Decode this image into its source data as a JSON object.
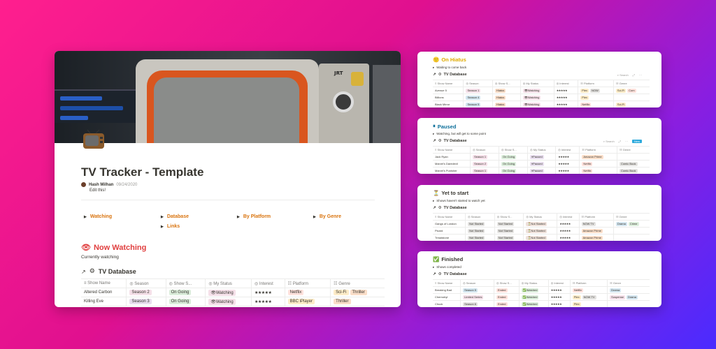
{
  "main": {
    "page_icon": "tv-icon",
    "title": "TV Tracker - Template",
    "author": "Hash Milhan",
    "date": "09/24/2020",
    "edit_note": "Edit this!",
    "toggles": [
      "Watching",
      "Database",
      "Links",
      "By Platform",
      "By Genre"
    ],
    "section": {
      "emoji": "👁",
      "title": "Now Watching",
      "subtitle": "Currently watching"
    },
    "db_title": "TV Database",
    "columns": [
      "Show Name",
      "Season",
      "Show S...",
      "My Status",
      "Interest",
      "Platform",
      "Genre"
    ],
    "rows": [
      {
        "name": "Altered Carbon",
        "season": "Season 2",
        "show_status": "On Going",
        "my_status": "👁Watching",
        "interest": "★★★★★",
        "platform": [
          "Netflix"
        ],
        "genre": [
          "Sci-Fi",
          "Thriller"
        ]
      },
      {
        "name": "Killing Eve",
        "season": "Season 3",
        "show_status": "On Going",
        "my_status": "👁Watching",
        "interest": "★★★★★",
        "platform": [
          "BBC iPlayer"
        ],
        "genre": [
          "Thriller"
        ]
      }
    ]
  },
  "hiatus": {
    "emoji": "🙂",
    "title": "On Hiatus",
    "subtitle": "Waiting to come back",
    "db_title": "TV Database",
    "search": "Search",
    "new": "New",
    "columns": [
      "Show Name",
      "Season",
      "Show S...",
      "My Status",
      "Interest",
      "Platform",
      "Genre"
    ],
    "rows": [
      {
        "name": "Avenue 5",
        "season": "Season 1",
        "show_status": "Hiatus",
        "my_status": "👁Watching",
        "interest": "★★★★★",
        "platform": [
          "Plex",
          "NOW"
        ],
        "genre": [
          "Sci-Fi",
          "Com"
        ]
      },
      {
        "name": "Billions",
        "season": "Season 4",
        "show_status": "Hiatus",
        "my_status": "👁Watching",
        "interest": "★★★★★",
        "platform": [
          "Plex"
        ],
        "genre": []
      },
      {
        "name": "Black Mirror",
        "season": "Season 5",
        "show_status": "Hiatus",
        "my_status": "👁Watching",
        "interest": "★★★★★",
        "platform": [
          "Netflix"
        ],
        "genre": [
          "Sci-Fi"
        ]
      }
    ]
  },
  "paused": {
    "emoji": "⏸",
    "title": "Paused",
    "subtitle": "Watching, but will get to some point",
    "db_title": "TV Database",
    "search": "Search",
    "new": "New",
    "columns": [
      "Show Name",
      "Season",
      "Show S...",
      "My Status",
      "Interest",
      "Platform",
      "Genre"
    ],
    "rows": [
      {
        "name": "Jack Ryan",
        "season": "Season 1",
        "show_status": "On Going",
        "my_status": "⏸Paused",
        "interest": "★★★★★",
        "platform": [
          "Amazon Prime"
        ],
        "genre": []
      },
      {
        "name": "Marvel's Daredevil",
        "season": "Season 2",
        "show_status": "On Going",
        "my_status": "⏸Paused",
        "interest": "★★★★★",
        "platform": [
          "Netflix"
        ],
        "genre": [
          "Comic Book"
        ]
      },
      {
        "name": "Marvel's Punisher",
        "season": "Season 1",
        "show_status": "On Going",
        "my_status": "⏸Paused",
        "interest": "★★★★★",
        "platform": [
          "Netflix"
        ],
        "genre": [
          "Comic Book"
        ]
      }
    ]
  },
  "yet": {
    "emoji": "⏳",
    "title": "Yet to start",
    "subtitle": "Shows haven't started to watch yet",
    "db_title": "TV Database",
    "columns": [
      "Show Name",
      "Season",
      "Show S...",
      "My Status",
      "Interest",
      "Platform",
      "Genre"
    ],
    "rows": [
      {
        "name": "Gangs of London",
        "season": "Not Started",
        "show_status": "Not Started",
        "my_status": "⏳Not Started",
        "interest": "★★★★★",
        "platform": [
          "NOW TV"
        ],
        "genre": [
          "Drama",
          "Crime"
        ]
      },
      {
        "name": "Picard",
        "season": "Not Started",
        "show_status": "Not Started",
        "my_status": "⏳Not Started",
        "interest": "★★★★★",
        "platform": [
          "Amazon Prime"
        ],
        "genre": []
      },
      {
        "name": "Treadstone",
        "season": "Not Started",
        "show_status": "Not Started",
        "my_status": "⏳Not Started",
        "interest": "★★★★★",
        "platform": [
          "Amazon Prime"
        ],
        "genre": []
      }
    ]
  },
  "finished": {
    "emoji": "✅",
    "title": "Finished",
    "subtitle": "Shows completed",
    "db_title": "TV Database",
    "columns": [
      "Show Name",
      "Season",
      "Show S...",
      "My Status",
      "Interest",
      "Platform",
      "Genre"
    ],
    "rows": [
      {
        "name": "Breaking Bad",
        "season": "Season 5",
        "show_status": "Ended",
        "my_status": "✅Watched",
        "interest": "★★★★★",
        "platform": [
          "Netflix"
        ],
        "genre": [
          "Drama"
        ]
      },
      {
        "name": "Chernobyl",
        "season": "Limited Series",
        "show_status": "Ended",
        "my_status": "✅Watched",
        "interest": "★★★★★",
        "platform": [
          "Plex",
          "NOW TV"
        ],
        "genre": [
          "Suspense",
          "Drama"
        ]
      },
      {
        "name": "Chuck",
        "season": "Season 6",
        "show_status": "Ended",
        "my_status": "✅Watched",
        "interest": "★★★★★",
        "platform": [
          "Plex"
        ],
        "genre": []
      }
    ]
  },
  "colors": {
    "pink_tag": "#f5e0e9",
    "green_tag": "#dbeddb",
    "purple_tag": "#e8deee",
    "orange_tag": "#fadec9",
    "yellow_tag": "#fdecc8",
    "red_tag": "#ffe2dd",
    "gray_tag": "#e3e2e0",
    "blue_tag": "#d3e5ef",
    "brown_tag": "#eee0da"
  }
}
